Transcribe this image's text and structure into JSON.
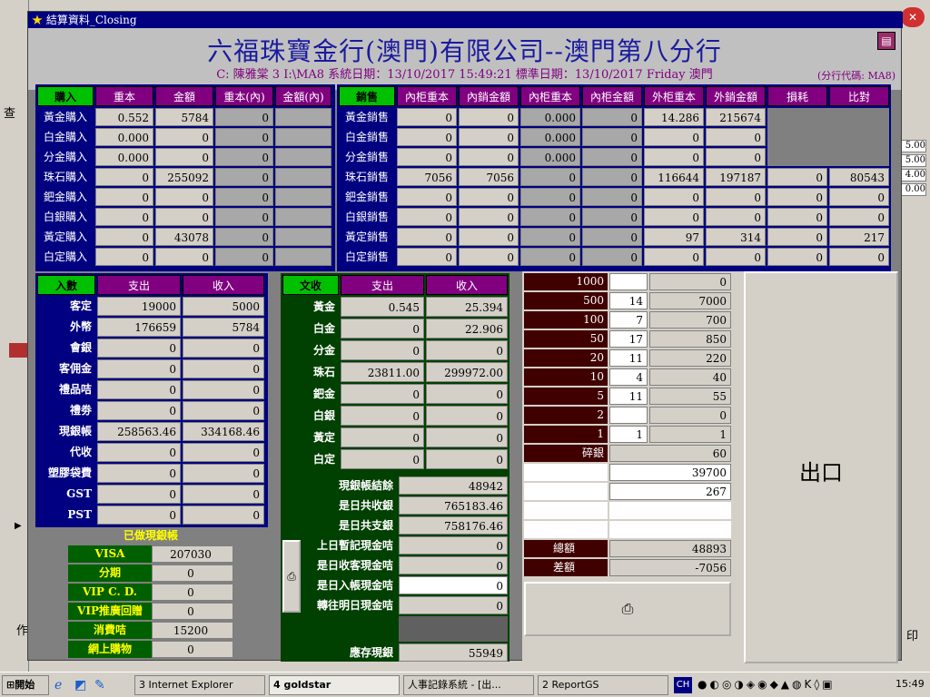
{
  "window": {
    "title": "結算資料_Closing"
  },
  "header": {
    "company": "六福珠寶金行(澳門)有限公司--澳門第八分行",
    "subline": "C: 陳雅棠  3  I:\\MA8  系統日期：13/10/2017  15:49:21  標準日期：13/10/2017 Friday 澳門",
    "branch_code": "(分行代碼: MA8)"
  },
  "buy": {
    "title": "購入",
    "cols": [
      "重本",
      "金額",
      "重本(內)",
      "金額(內)"
    ],
    "rows": [
      {
        "label": "黃金購入",
        "v": [
          "0.552",
          "5784",
          "0",
          ""
        ]
      },
      {
        "label": "白金購入",
        "v": [
          "0.000",
          "0",
          "0",
          ""
        ]
      },
      {
        "label": "分金購入",
        "v": [
          "0.000",
          "0",
          "0",
          ""
        ]
      },
      {
        "label": "珠石購入",
        "v": [
          "0",
          "255092",
          "0",
          ""
        ]
      },
      {
        "label": "鈀金購入",
        "v": [
          "0",
          "0",
          "0",
          ""
        ]
      },
      {
        "label": "白銀購入",
        "v": [
          "0",
          "0",
          "0",
          ""
        ]
      },
      {
        "label": "黃定購入",
        "v": [
          "0",
          "43078",
          "0",
          ""
        ]
      },
      {
        "label": "白定購入",
        "v": [
          "0",
          "0",
          "0",
          ""
        ]
      }
    ]
  },
  "sell": {
    "title": "銷售",
    "cols": [
      "內柜重本",
      "內銷金額",
      "內柜重本",
      "內柜金額",
      "外柜重本",
      "外銷金額",
      "損耗",
      "比對"
    ],
    "rows": [
      {
        "label": "黃金銷售",
        "v": [
          "0",
          "0",
          "0.000",
          "0",
          "14.286",
          "215674",
          "",
          ""
        ]
      },
      {
        "label": "白金銷售",
        "v": [
          "0",
          "0",
          "0.000",
          "0",
          "0",
          "0",
          "",
          ""
        ]
      },
      {
        "label": "分金銷售",
        "v": [
          "0",
          "0",
          "0.000",
          "0",
          "0",
          "0",
          "",
          ""
        ]
      },
      {
        "label": "珠石銷售",
        "v": [
          "7056",
          "7056",
          "0",
          "0",
          "116644",
          "197187",
          "0",
          "80543"
        ]
      },
      {
        "label": "鈀金銷售",
        "v": [
          "0",
          "0",
          "0",
          "0",
          "0",
          "0",
          "0",
          "0"
        ]
      },
      {
        "label": "白銀銷售",
        "v": [
          "0",
          "0",
          "0",
          "0",
          "0",
          "0",
          "0",
          "0"
        ]
      },
      {
        "label": "黃定銷售",
        "v": [
          "0",
          "0",
          "0",
          "0",
          "97",
          "314",
          "0",
          "217"
        ]
      },
      {
        "label": "白定銷售",
        "v": [
          "0",
          "0",
          "0",
          "0",
          "0",
          "0",
          "0",
          "0"
        ]
      }
    ]
  },
  "income": {
    "title": "入數",
    "cols": [
      "支出",
      "收入"
    ],
    "rows": [
      {
        "label": "客定",
        "v": [
          "19000",
          "5000"
        ]
      },
      {
        "label": "外幣",
        "v": [
          "176659",
          "5784"
        ]
      },
      {
        "label": "會銀",
        "v": [
          "0",
          "0"
        ]
      },
      {
        "label": "客佣金",
        "v": [
          "0",
          "0"
        ]
      },
      {
        "label": "禮品咭",
        "v": [
          "0",
          "0"
        ]
      },
      {
        "label": "禮劵",
        "v": [
          "0",
          "0"
        ]
      },
      {
        "label": "現銀帳",
        "v": [
          "258563.46",
          "334168.46"
        ]
      },
      {
        "label": "代收",
        "v": [
          "0",
          "0"
        ]
      },
      {
        "label": "塑膠袋費",
        "v": [
          "0",
          "0"
        ]
      },
      {
        "label": "GST",
        "v": [
          "0",
          "0"
        ]
      },
      {
        "label": "PST",
        "v": [
          "0",
          "0"
        ]
      }
    ]
  },
  "goods": {
    "title": "文收",
    "cols": [
      "支出",
      "收入"
    ],
    "rows": [
      {
        "label": "黃金",
        "v": [
          "0.545",
          "25.394"
        ]
      },
      {
        "label": "白金",
        "v": [
          "0",
          "22.906"
        ]
      },
      {
        "label": "分金",
        "v": [
          "0",
          "0"
        ]
      },
      {
        "label": "珠石",
        "v": [
          "23811.00",
          "299972.00"
        ]
      },
      {
        "label": "鈀金",
        "v": [
          "0",
          "0"
        ]
      },
      {
        "label": "白銀",
        "v": [
          "0",
          "0"
        ]
      },
      {
        "label": "黃定",
        "v": [
          "0",
          "0"
        ]
      },
      {
        "label": "白定",
        "v": [
          "0",
          "0"
        ]
      }
    ]
  },
  "done": {
    "title": "已做現銀帳",
    "rows": [
      {
        "label": "VISA",
        "v": "207030"
      },
      {
        "label": "分期",
        "v": "0"
      },
      {
        "label": "VIP C. D.",
        "v": "0"
      },
      {
        "label": "VIP推廣回贈",
        "v": "0"
      },
      {
        "label": "消費咭",
        "v": "15200"
      },
      {
        "label": "網上購物",
        "v": "0"
      }
    ]
  },
  "summary": {
    "rows": [
      {
        "label": "現銀帳結餘",
        "v": "48942"
      },
      {
        "label": "是日共收銀",
        "v": "765183.46"
      },
      {
        "label": "是日共支銀",
        "v": "758176.46"
      },
      {
        "label": "上日暫記現金咭",
        "v": "0"
      },
      {
        "label": "是日收客現金咭",
        "v": "0"
      },
      {
        "label": "是日入帳現金咭",
        "v": "0"
      },
      {
        "label": "轉往明日現金咭",
        "v": "0"
      }
    ],
    "store_label": "應存現銀",
    "store_value": "55949"
  },
  "cash": {
    "rows": [
      {
        "d": "1000",
        "q": "",
        "a": "0"
      },
      {
        "d": "500",
        "q": "14",
        "a": "7000"
      },
      {
        "d": "100",
        "q": "7",
        "a": "700"
      },
      {
        "d": "50",
        "q": "17",
        "a": "850"
      },
      {
        "d": "20",
        "q": "11",
        "a": "220"
      },
      {
        "d": "10",
        "q": "4",
        "a": "40"
      },
      {
        "d": "5",
        "q": "11",
        "a": "55"
      },
      {
        "d": "2",
        "q": "",
        "a": "0"
      },
      {
        "d": "1",
        "q": "1",
        "a": "1"
      }
    ],
    "coins_label": "碎銀",
    "coins": "60",
    "extra1": "39700",
    "extra2": "267",
    "total_label": "總額",
    "total": "48893",
    "diff_label": "差額",
    "diff": "-7056"
  },
  "exit_label": "出口",
  "taskbar": {
    "start": "開始",
    "ie": "3 Internet Explorer",
    "goldstar": "4 goldstar",
    "hr": "人事記錄系統 - [出...",
    "report": "2 ReportGS",
    "lang": "CH",
    "clock": "15:49"
  },
  "bg": {
    "left_char": "查",
    "right_char": "印",
    "left_char2": "作",
    "r1": "5.00",
    "r2": "5.00",
    "r3": "4.00",
    "r4": "0.00"
  }
}
